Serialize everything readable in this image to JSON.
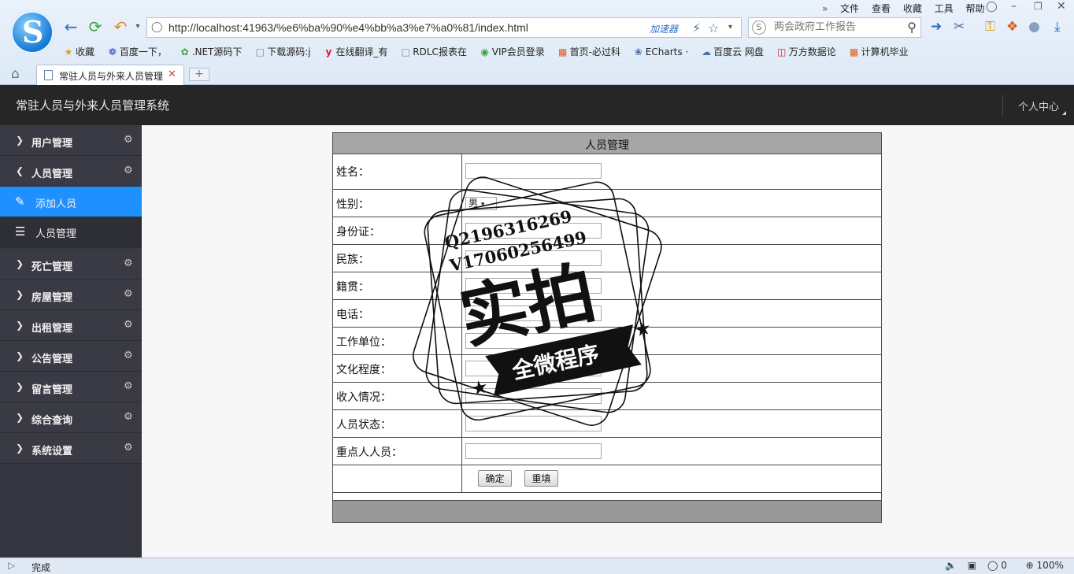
{
  "browser": {
    "menu": [
      "文件",
      "查看",
      "收藏",
      "工具",
      "帮助"
    ],
    "address": "http://localhost:41963/%e6%ba%90%e4%bb%a3%e7%a0%81/index.html",
    "accelerator": "加速器",
    "search_placeholder": "两会政府工作报告",
    "bookmarks": [
      "收藏",
      "百度一下，",
      ".NET源码下",
      "下载源码:j",
      "在线翻译_有",
      "RDLC报表在",
      "VIP会员登录",
      "首页-必过科",
      "ECharts ·",
      "百度云 网盘",
      "万方数据论",
      "计算机毕业"
    ],
    "tab_title": "常驻人员与外来人员管理",
    "status": "完成",
    "status_count": "0",
    "zoom": "100%"
  },
  "app": {
    "title": "常驻人员与外来人员管理系统",
    "user_center": "个人中心"
  },
  "sidebar": {
    "items": [
      {
        "label": "用户管理"
      },
      {
        "label": "人员管理"
      },
      {
        "label": "添加人员"
      },
      {
        "label": "人员管理"
      },
      {
        "label": "死亡管理"
      },
      {
        "label": "房屋管理"
      },
      {
        "label": "出租管理"
      },
      {
        "label": "公告管理"
      },
      {
        "label": "留言管理"
      },
      {
        "label": "综合查询"
      },
      {
        "label": "系统设置"
      }
    ]
  },
  "form": {
    "title": "人员管理",
    "fields": [
      {
        "label": "姓名："
      },
      {
        "label": "性别：",
        "value": "男"
      },
      {
        "label": "身份证："
      },
      {
        "label": "民族："
      },
      {
        "label": "籍贯："
      },
      {
        "label": "电话："
      },
      {
        "label": "工作单位："
      },
      {
        "label": "文化程度："
      },
      {
        "label": "收入情况："
      },
      {
        "label": "人员状态："
      },
      {
        "label": "重点人人员："
      }
    ],
    "submit": "确定",
    "reset": "重填"
  },
  "watermark": {
    "line1": "Q2196316269",
    "line2": "V17060256499",
    "big": "实拍",
    "banner": "全微程序"
  }
}
